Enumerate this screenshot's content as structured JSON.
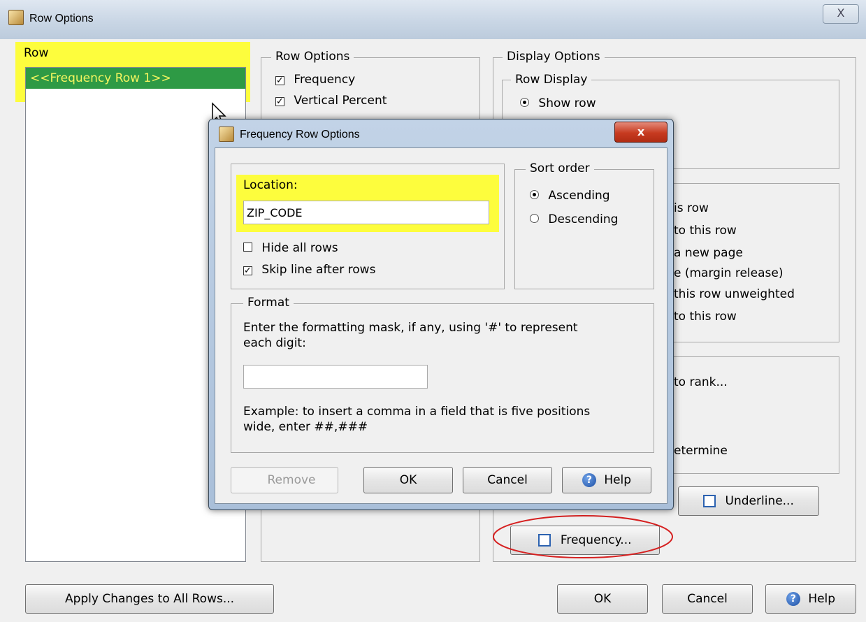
{
  "window": {
    "title": "Row Options",
    "close_glyph": "X"
  },
  "row_panel": {
    "label": "Row",
    "items": [
      "<<Frequency Row 1>>"
    ]
  },
  "row_options": {
    "label": "Row Options",
    "items": [
      {
        "label": "Frequency",
        "checked": true
      },
      {
        "label": "Vertical Percent",
        "checked": true
      }
    ]
  },
  "display_options": {
    "label": "Display Options",
    "row_display": {
      "label": "Row Display",
      "show_row": "Show row"
    },
    "partial_lines": [
      "is row",
      "to this row",
      "a new page",
      "e (margin release)",
      "this row unweighted",
      "to this row"
    ],
    "partial_rank": "to rank...",
    "partial_determine": "etermine"
  },
  "bottom_buttons": {
    "apply_all": "Apply Changes to All Rows...",
    "ok": "OK",
    "cancel": "Cancel",
    "help": "Help"
  },
  "side_buttons": {
    "underline": "Underline...",
    "frequency": "Frequency..."
  },
  "dialog": {
    "title": "Frequency Row Options",
    "close_glyph": "x",
    "location_label": "Location:",
    "location_value": "ZIP_CODE",
    "hide_all_rows": {
      "label": "Hide all rows",
      "checked": false
    },
    "skip_line": {
      "label": "Skip line after rows",
      "checked": true
    },
    "sort_order": {
      "label": "Sort order",
      "ascending": {
        "label": "Ascending",
        "selected": true
      },
      "descending": {
        "label": "Descending",
        "selected": false
      }
    },
    "format": {
      "label": "Format",
      "instruction": "Enter the formatting mask, if any, using '#' to represent each digit:",
      "mask_value": "",
      "example": "Example: to insert a comma in a field that is five positions wide, enter ##,###"
    },
    "buttons": {
      "remove": "Remove",
      "ok": "OK",
      "cancel": "Cancel",
      "help": "Help"
    }
  },
  "colors": {
    "highlight": "#fdfd3d",
    "selected_row_bg": "#2e9a45",
    "selected_row_fg": "#f5f560",
    "annotation": "#d62020"
  }
}
